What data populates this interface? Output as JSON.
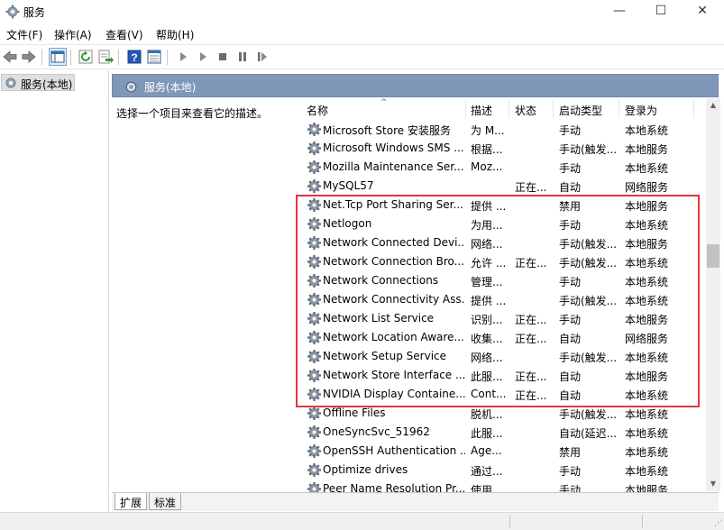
{
  "window": {
    "title": "服务",
    "minimize_glyph": "—",
    "maximize_glyph": "☐",
    "close_glyph": "✕"
  },
  "menu": [
    "文件(F)",
    "操作(A)",
    "查看(V)",
    "帮助(H)"
  ],
  "tree": {
    "root_label": "服务(本地)"
  },
  "pane": {
    "header_title": "服务(本地)",
    "description_prompt": "选择一个项目来查看它的描述。"
  },
  "columns": {
    "name": "名称",
    "description": "描述",
    "status": "状态",
    "startup": "启动类型",
    "logon": "登录为",
    "sort_glyph": "^"
  },
  "services": [
    {
      "name": "Microsoft Store 安装服务",
      "description": "为 M...",
      "status": "",
      "startup": "手动",
      "logon": "本地系统"
    },
    {
      "name": "Microsoft Windows SMS ...",
      "description": "根据...",
      "status": "",
      "startup": "手动(触发...",
      "logon": "本地服务"
    },
    {
      "name": "Mozilla Maintenance Ser...",
      "description": "Moz...",
      "status": "",
      "startup": "手动",
      "logon": "本地系统"
    },
    {
      "name": "MySQL57",
      "description": "",
      "status": "正在...",
      "startup": "自动",
      "logon": "网络服务"
    },
    {
      "name": "Net.Tcp Port Sharing Ser...",
      "description": "提供 ...",
      "status": "",
      "startup": "禁用",
      "logon": "本地服务"
    },
    {
      "name": "Netlogon",
      "description": "为用...",
      "status": "",
      "startup": "手动",
      "logon": "本地系统"
    },
    {
      "name": "Network Connected Devi...",
      "description": "网络...",
      "status": "",
      "startup": "手动(触发...",
      "logon": "本地服务"
    },
    {
      "name": "Network Connection Bro...",
      "description": "允许 ...",
      "status": "正在...",
      "startup": "手动(触发...",
      "logon": "本地系统"
    },
    {
      "name": "Network Connections",
      "description": "管理...",
      "status": "",
      "startup": "手动",
      "logon": "本地系统"
    },
    {
      "name": "Network Connectivity Ass...",
      "description": "提供 ...",
      "status": "",
      "startup": "手动(触发...",
      "logon": "本地系统"
    },
    {
      "name": "Network List Service",
      "description": "识别...",
      "status": "正在...",
      "startup": "手动",
      "logon": "本地服务"
    },
    {
      "name": "Network Location Aware...",
      "description": "收集...",
      "status": "正在...",
      "startup": "自动",
      "logon": "网络服务"
    },
    {
      "name": "Network Setup Service",
      "description": "网络...",
      "status": "",
      "startup": "手动(触发...",
      "logon": "本地系统"
    },
    {
      "name": "Network Store Interface ...",
      "description": "此服...",
      "status": "正在...",
      "startup": "自动",
      "logon": "本地服务"
    },
    {
      "name": "NVIDIA Display Containe...",
      "description": "Cont...",
      "status": "正在...",
      "startup": "自动",
      "logon": "本地系统"
    },
    {
      "name": "Offline Files",
      "description": "脱机...",
      "status": "",
      "startup": "手动(触发...",
      "logon": "本地系统"
    },
    {
      "name": "OneSyncSvc_51962",
      "description": "此服...",
      "status": "",
      "startup": "自动(延迟...",
      "logon": "本地系统"
    },
    {
      "name": "OpenSSH Authentication ...",
      "description": "Age...",
      "status": "",
      "startup": "禁用",
      "logon": "本地系统"
    },
    {
      "name": "Optimize drives",
      "description": "通过...",
      "status": "",
      "startup": "手动",
      "logon": "本地系统"
    },
    {
      "name": "Peer Name Resolution Pr...",
      "description": "使用...",
      "status": "",
      "startup": "手动",
      "logon": "本地服务"
    }
  ],
  "tabs": [
    "扩展",
    "标准"
  ],
  "colors": {
    "header_strip": "#7f97b8",
    "highlight_border": "#e0373d",
    "tree_selected": "#dfdfdf"
  }
}
